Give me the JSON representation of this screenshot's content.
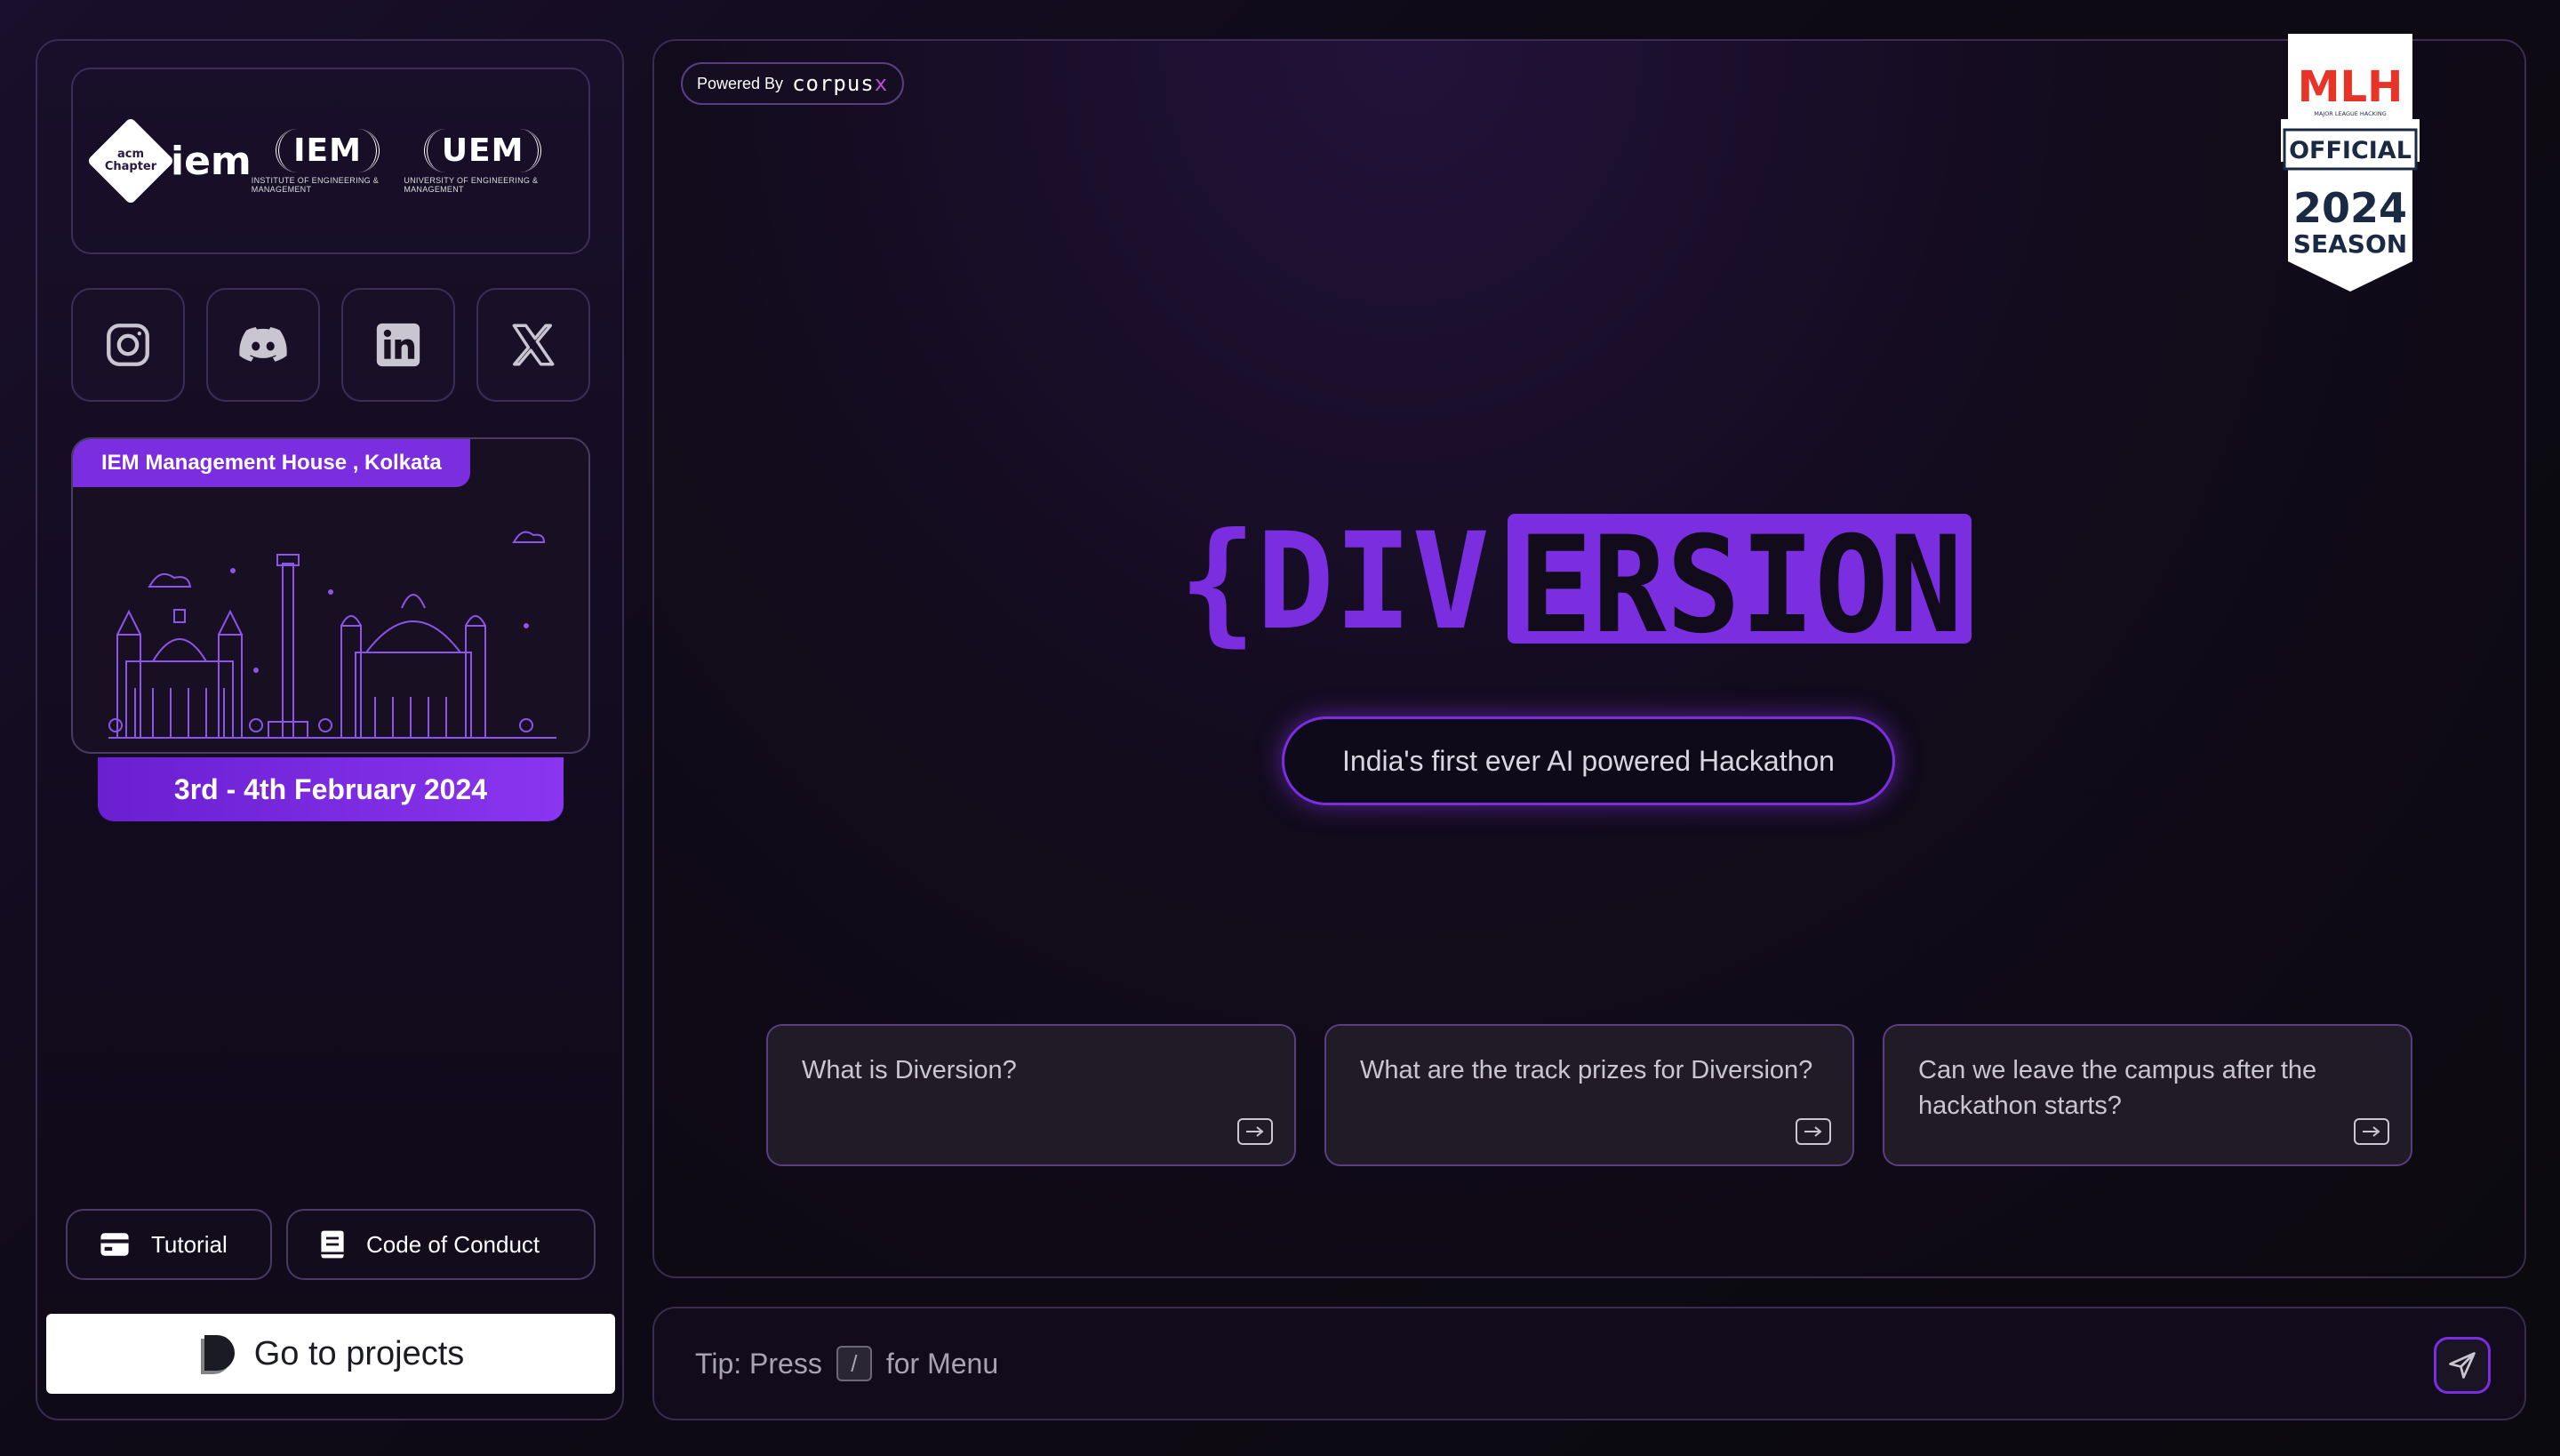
{
  "sidebar": {
    "logos": {
      "acm_badge": "acm Chapter",
      "acm_word": "iem",
      "iem_seal": "IEM",
      "iem_sub": "INSTITUTE OF ENGINEERING & MANAGEMENT",
      "uem_seal": "UEM",
      "uem_sub": "UNIVERSITY OF ENGINEERING & MANAGEMENT"
    },
    "socials": [
      "instagram-icon",
      "discord-icon",
      "linkedin-icon",
      "x-icon"
    ],
    "venue": "IEM Management House , Kolkata",
    "date": "3rd - 4th February 2024",
    "tutorial_label": "Tutorial",
    "coc_label": "Code of Conduct",
    "projects_label": "Go to projects"
  },
  "main": {
    "powered_by": "Powered By",
    "powered_brand": "corpus",
    "powered_brand_x": "x",
    "mlh": {
      "top": "MLH",
      "small": "MAJOR LEAGUE HACKING",
      "official": "OFFICIAL",
      "year": "2024",
      "season": "SEASON"
    },
    "title_left": "{DIV",
    "title_right": "ERSION",
    "tagline": "India's first ever AI powered Hackathon",
    "suggestions": [
      "What is Diversion?",
      "What are the track prizes for Diversion?",
      "Can we leave the campus after the hackathon starts?"
    ]
  },
  "tipbar": {
    "prefix": "Tip: Press",
    "key": "/",
    "suffix": "for Menu"
  },
  "colors": {
    "accent": "#8a35f0",
    "accent_dark": "#6a1fd0",
    "background": "#0c0912"
  }
}
